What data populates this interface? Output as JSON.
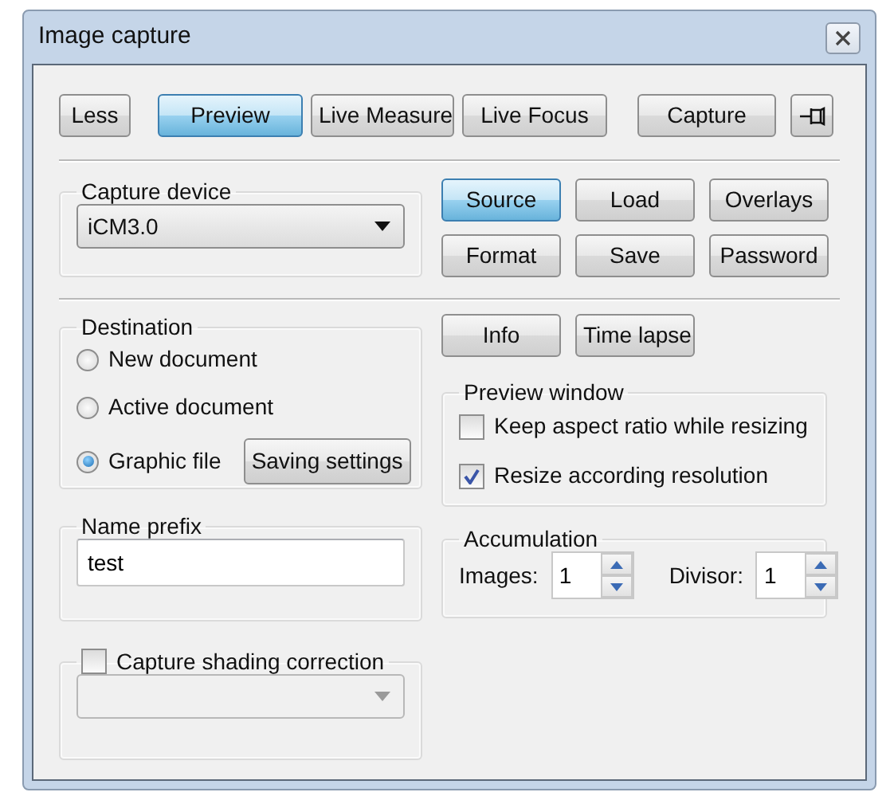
{
  "window": {
    "title": "Image capture"
  },
  "toolbar": [
    {
      "label": "Less",
      "pressed": false
    },
    {
      "label": "Preview",
      "pressed": true
    },
    {
      "label": "Live Measure",
      "pressed": false
    },
    {
      "label": "Live Focus",
      "pressed": false
    },
    {
      "label": "Capture",
      "pressed": false
    }
  ],
  "capture_device": {
    "legend": "Capture device",
    "value": "iCM3.0"
  },
  "device_buttons": [
    {
      "label": "Source",
      "pressed": true
    },
    {
      "label": "Load",
      "pressed": false
    },
    {
      "label": "Overlays",
      "pressed": false
    },
    {
      "label": "Format",
      "pressed": false
    },
    {
      "label": "Save",
      "pressed": false
    },
    {
      "label": "Password",
      "pressed": false
    }
  ],
  "destination": {
    "legend": "Destination",
    "options": [
      {
        "label": "New document",
        "selected": false
      },
      {
        "label": "Active document",
        "selected": false
      },
      {
        "label": "Graphic file",
        "selected": true
      }
    ],
    "saving_settings": "Saving settings"
  },
  "name_prefix": {
    "legend": "Name prefix",
    "value": "test"
  },
  "shading": {
    "label": "Capture shading correction",
    "checked": false,
    "disabled": true
  },
  "info_buttons": [
    "Info",
    "Time lapse"
  ],
  "preview_window": {
    "legend": "Preview window",
    "options": [
      {
        "label": "Keep aspect ratio while resizing",
        "checked": false
      },
      {
        "label": "Resize according resolution",
        "checked": true
      }
    ]
  },
  "accumulation": {
    "legend": "Accumulation",
    "fields": [
      {
        "label": "Images:",
        "value": "1"
      },
      {
        "label": "Divisor:",
        "value": "1"
      }
    ]
  }
}
